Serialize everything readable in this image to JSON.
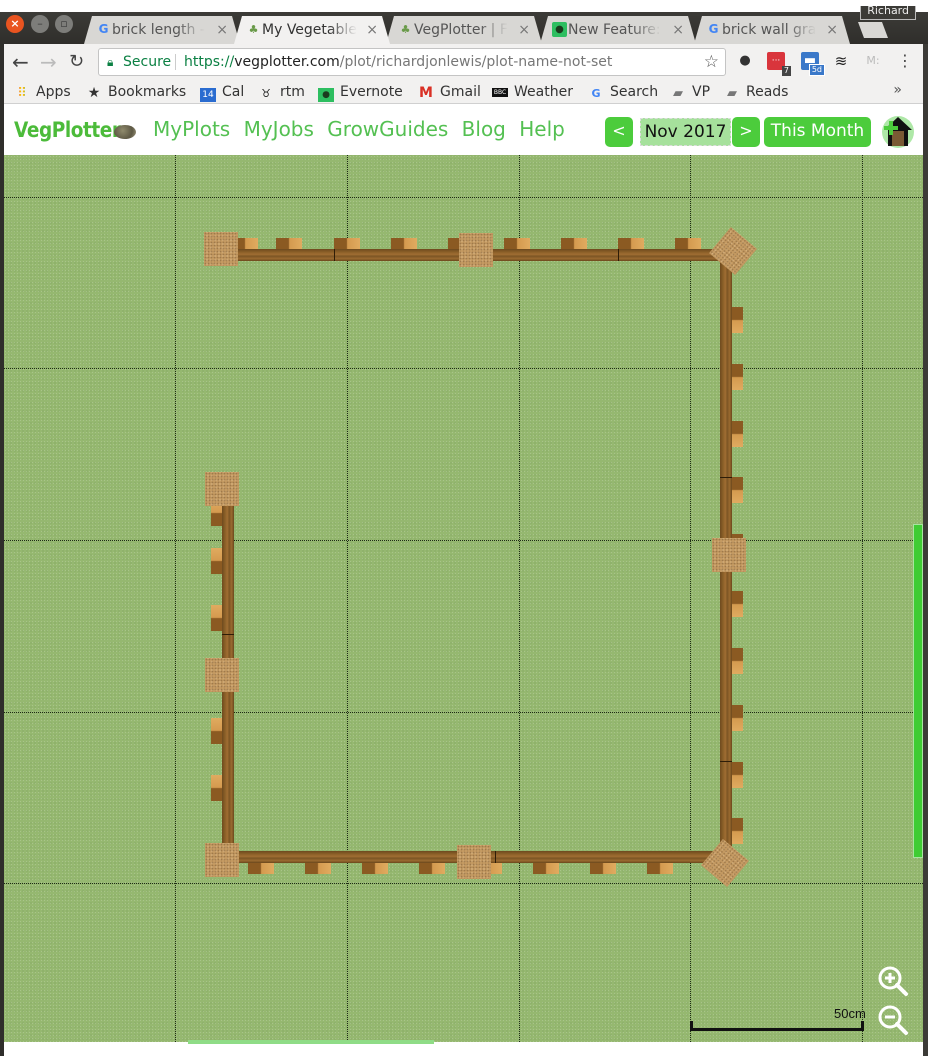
{
  "browser": {
    "profile_name": "Richard",
    "tabs": [
      {
        "label": "brick length -",
        "favicon": "google-icon",
        "active": false
      },
      {
        "label": "My Vegetable",
        "favicon": "vegplotter-icon",
        "active": true
      },
      {
        "label": "VegPlotter | F",
        "favicon": "vegplotter-icon",
        "active": false
      },
      {
        "label": "New Feature:",
        "favicon": "evernote-icon",
        "active": false
      },
      {
        "label": "brick wall gra",
        "favicon": "google-icon",
        "active": false
      }
    ],
    "close_glyph": "×",
    "address": {
      "secure_label": "Secure",
      "scheme": "https://",
      "host": "vegplotter.com",
      "path": "/plot/richardjonlewis/plot-name-not-set"
    },
    "extensions": [
      {
        "name": "evernote-extension-icon",
        "badge": ""
      },
      {
        "name": "todo-extension-icon",
        "badge": "7"
      },
      {
        "name": "calendar-extension-icon",
        "badge": "5d"
      },
      {
        "name": "buffer-extension-icon",
        "badge": ""
      },
      {
        "name": "mercury-extension-icon",
        "badge": "M:"
      }
    ],
    "bookmarks": [
      {
        "label": "Apps",
        "icon": "apps-grid-icon"
      },
      {
        "label": "Bookmarks",
        "icon": "star-icon"
      },
      {
        "label": "Cal",
        "icon": "calendar-icon",
        "icon_text": "14"
      },
      {
        "label": "rtm",
        "icon": "rtm-cow-icon"
      },
      {
        "label": "Evernote",
        "icon": "evernote-icon"
      },
      {
        "label": "Gmail",
        "icon": "gmail-icon"
      },
      {
        "label": "Weather",
        "icon": "bbc-icon",
        "icon_text": "BBC"
      },
      {
        "label": "Search",
        "icon": "google-icon"
      },
      {
        "label": "VP",
        "icon": "folder-icon"
      },
      {
        "label": "Reads",
        "icon": "folder-icon"
      }
    ],
    "bookmarks_overflow": "»"
  },
  "app": {
    "logo": "VegPlotter",
    "nav": [
      "MyPlots",
      "MyJobs",
      "GrowGuides",
      "Blog",
      "Help"
    ],
    "prev_month_label": "<",
    "current_month": "Nov 2017",
    "next_month_label": ">",
    "this_month_label": "This Month",
    "home_button": "add-home-icon",
    "colors": {
      "brand_green": "#4ccc3c",
      "nav_green": "#54c052",
      "date_bg": "#a6e19c",
      "grass": "#95b870"
    }
  },
  "plot": {
    "scale_label": "50cm",
    "zoom_in": "zoom-in-icon",
    "zoom_out": "zoom-out-icon",
    "vertical_scroll_fraction_visible": 0.38
  }
}
